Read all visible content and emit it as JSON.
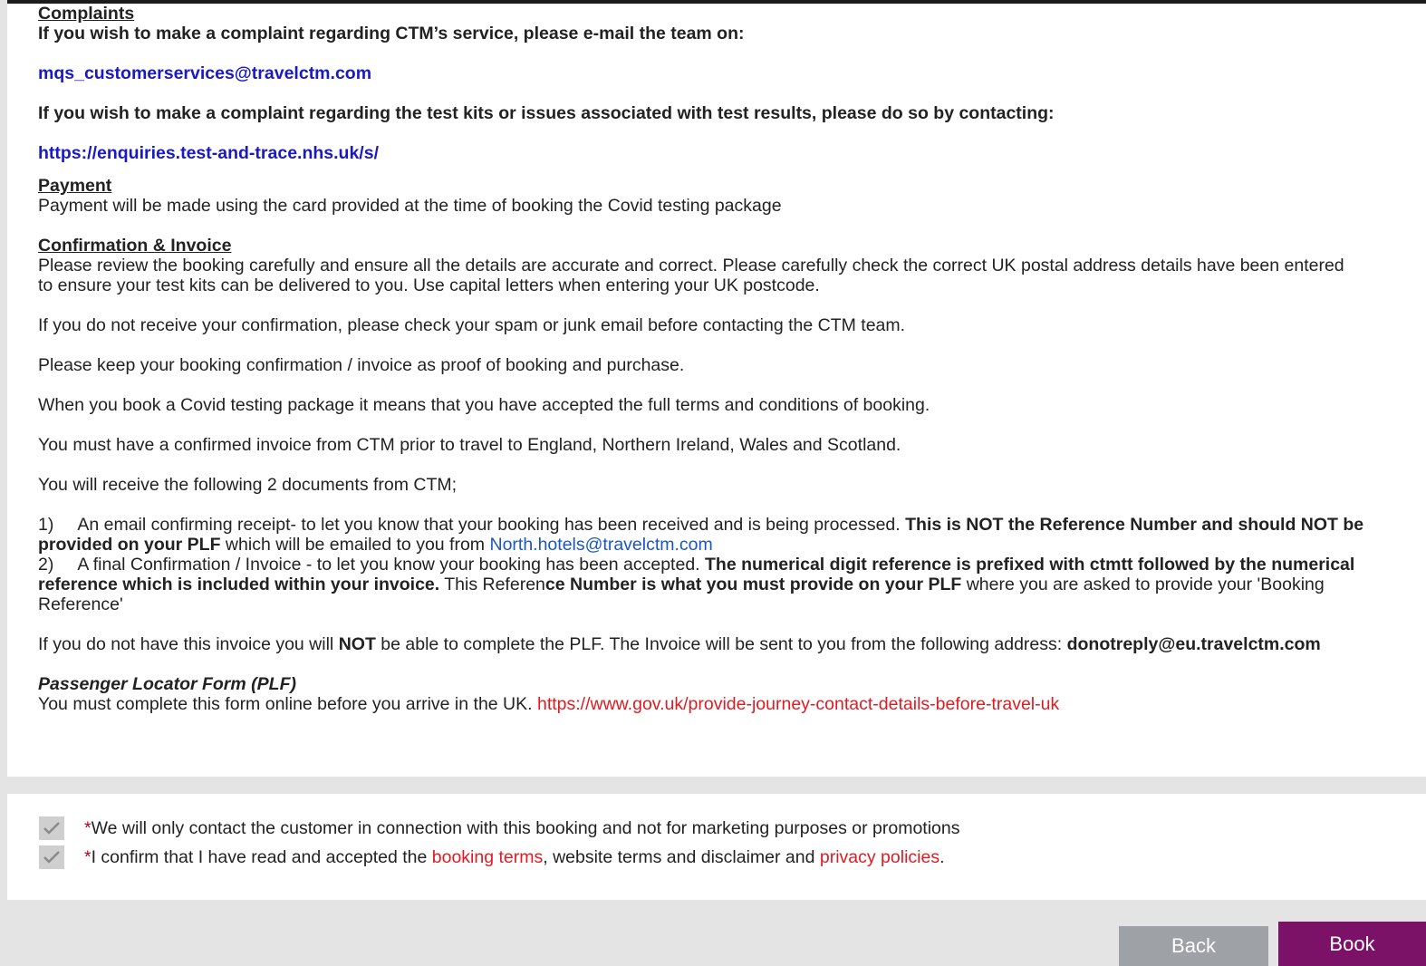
{
  "terms": {
    "complaints": {
      "heading": "Complaints ",
      "line1": "If you wish to make a complaint regarding CTM’s service, please e-mail the team on:",
      "email": "mqs_customerservices@travelctm.com",
      "line2": "If you wish to make a complaint regarding the test kits or issues associated with test results, please do so by contacting:",
      "nhs_link": "https://enquiries.test-and-trace.nhs.uk/s/"
    },
    "payment": {
      "heading": "Payment",
      "line1": "Payment will be made using the card provided at the time of booking the Covid testing package"
    },
    "confirmation": {
      "heading": "Confirmation & Invoice",
      "para1_line1": "Please review the booking carefully and ensure all the details are accurate and correct. Please carefully check the correct UK postal address details have been entered",
      "para1_line2": "to ensure your test kits can be delivered to you. Use capital letters when entering your UK postcode.",
      "para2": "If you do not receive your confirmation, please check your spam or junk email before contacting the CTM team.",
      "para3": "Please keep your booking confirmation / invoice as proof of booking and purchase.",
      "para4": "When you book a Covid testing package it means that you have accepted the full terms and conditions of booking.",
      "para5": "You must have a confirmed invoice from CTM prior to travel to England, Northern Ireland, Wales and Scotland.",
      "para6": "You will receive the following 2 documents from CTM;",
      "item1": {
        "number": "1)",
        "text_a": "An email confirming receipt- to let you know that your booking has been received and is being processed. ",
        "bold_a": "This is NOT the Reference Number and should NOT be provided on your PLF",
        "text_b": " which will be emailed to you from ",
        "link": "North.hotels@travelctm.com"
      },
      "item2": {
        "number": "2)",
        "text_a": "A final Confirmation / Invoice - to let you know your booking has been accepted. ",
        "bold_a": "The numerical digit reference is prefixed with ctmtt followed by the numerical reference which is included within your invoice.",
        "text_b": " This Referen",
        "bold_b": "ce Number is what you must provide on your PLF",
        "text_c": " where you are asked to provide your 'Booking Reference'"
      },
      "para7_a": "If you do not have this invoice you will ",
      "para7_bold1": "NOT",
      "para7_b": " be able to complete the PLF. The Invoice will be sent to you from the following address: ",
      "para7_bold2": "donotreply@eu.travelctm.com"
    },
    "plf": {
      "heading": "Passenger Locator Form (PLF)",
      "text": "You must complete this form online before you arrive in the UK. ",
      "link": "https://www.gov.uk/provide-journey-contact-details-before-travel-uk"
    }
  },
  "consent": {
    "item1": {
      "asterisk": "*",
      "text": "We will only contact the customer in connection with this booking and not for marketing purposes or promotions"
    },
    "item2": {
      "asterisk": "*",
      "text_a": "I confirm that I have read and accepted the ",
      "link1": "booking terms",
      "text_b": ", website terms and disclaimer and ",
      "link2": "privacy policies",
      "text_c": "."
    }
  },
  "footer": {
    "back_label": "Back",
    "book_label": "Book"
  },
  "colors": {
    "link_blue": "#1a1ac4",
    "link_blue_plain": "#1a56c4",
    "link_red": "#e01b22",
    "book_purple": "#7b1268",
    "back_grey": "#9ea2a7",
    "page_grey": "#e4e4e4"
  }
}
